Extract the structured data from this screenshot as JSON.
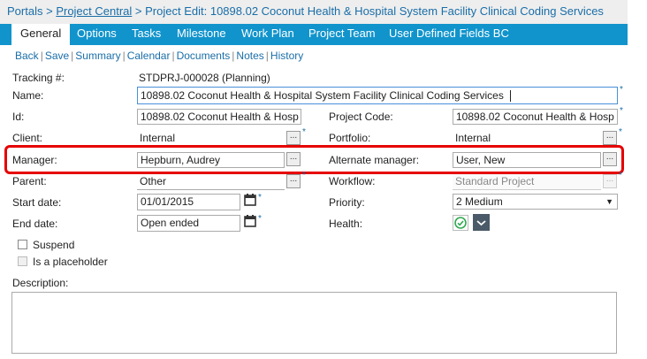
{
  "breadcrumb": {
    "portals": "Portals",
    "separator": ">",
    "project_central": "Project Central",
    "current": "Project Edit: 10898.02 Coconut Health & Hospital System Facility Clinical Coding Services"
  },
  "tabs": [
    {
      "label": "General"
    },
    {
      "label": "Options"
    },
    {
      "label": "Tasks"
    },
    {
      "label": "Milestone"
    },
    {
      "label": "Work Plan"
    },
    {
      "label": "Project Team"
    },
    {
      "label": "User Defined Fields BC"
    }
  ],
  "actions": {
    "back": "Back",
    "save": "Save",
    "summary": "Summary",
    "calendar": "Calendar",
    "documents": "Documents",
    "notes": "Notes",
    "history": "History",
    "separator": "|"
  },
  "form": {
    "tracking_label": "Tracking #:",
    "tracking_value": "STDPRJ-000028 (Planning)",
    "name_label": "Name:",
    "name_value": "10898.02 Coconut Health & Hospital System Facility Clinical Coding Services",
    "id_label": "Id:",
    "id_value": "10898.02 Coconut Health & Hosp",
    "project_code_label": "Project Code:",
    "project_code_value": "10898.02 Coconut Health & Hosp",
    "client_label": "Client:",
    "client_value": "Internal",
    "portfolio_label": "Portfolio:",
    "portfolio_value": "Internal",
    "manager_label": "Manager:",
    "manager_value": "Hepburn, Audrey",
    "alt_manager_label": "Alternate manager:",
    "alt_manager_value": "User, New",
    "parent_label": "Parent:",
    "parent_value": "Other",
    "workflow_label": "Workflow:",
    "workflow_value": "Standard Project",
    "start_date_label": "Start date:",
    "start_date_value": "01/01/2015",
    "priority_label": "Priority:",
    "priority_value": "2 Medium",
    "end_date_label": "End date:",
    "end_date_value": "Open ended",
    "health_label": "Health:",
    "suspend_label": "Suspend",
    "placeholder_label": "Is a placeholder",
    "description_label": "Description:",
    "required_mark": "*",
    "picker_glyph": "...",
    "dropdown_arrow": "▼"
  },
  "colors": {
    "tab_bar": "#1194cc",
    "link": "#1a6ea8",
    "highlight": "#e60000",
    "health_ok": "#2fa84f"
  },
  "icons": {
    "calendar": "calendar-icon",
    "health_ok": "check-circle-icon",
    "health_dropdown": "chevron-down-icon"
  }
}
